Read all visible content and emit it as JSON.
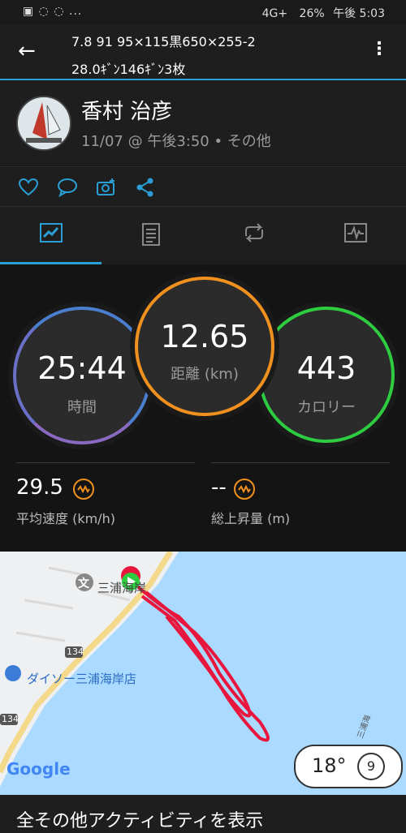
{
  "status_bar": {
    "left_icons": "▣ ◌ ◌ ...",
    "battery": "26%",
    "time": "午後 5:03",
    "signal": "4G+"
  },
  "app_bar": {
    "title_line1": "7.8 91 95×115黒650×255-2",
    "title_line2": "28.0ｷﾞﾝ146ｷﾞﾝ3枚"
  },
  "profile": {
    "name": "香村 治彦",
    "meta": "11/07 @ 午後3:50 • その他"
  },
  "actions": [
    "heart-icon",
    "comment-icon",
    "camera-add-icon",
    "share-icon"
  ],
  "tabs": [
    "summary-tab",
    "details-tab",
    "laps-tab",
    "charts-tab"
  ],
  "stats": {
    "time": {
      "value": "25:44",
      "label": "時間"
    },
    "distance": {
      "value": "12.65",
      "label": "距離 (km)"
    },
    "calories": {
      "value": "443",
      "label": "カロリー"
    },
    "avg_speed": {
      "value": "29.5",
      "label": "平均速度 (km/h)"
    },
    "ascent": {
      "value": "--",
      "label": "総上昇量 (m)"
    }
  },
  "map": {
    "poi1": "三浦海岸",
    "poi2": "ダイソー三浦海岸店",
    "road_label": "134",
    "road_label2": "134",
    "corner_label": "三浦海",
    "google": "Google",
    "temp": "18°",
    "wind": "9"
  },
  "bottom": {
    "text": "全その他アクティビティを表示"
  },
  "colors": {
    "accent": "#2a9fd6",
    "time_ring": "#6a70c8",
    "distance_ring": "#f0901e",
    "calorie_ring": "#2ecc40",
    "track": "#e8153c"
  }
}
